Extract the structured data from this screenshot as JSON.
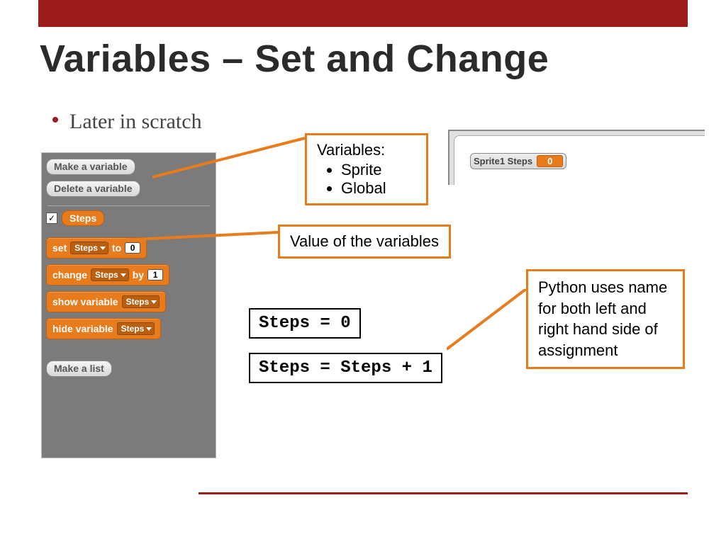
{
  "title": "Variables – Set and Change",
  "bullet": "Later in scratch",
  "scratch_panel": {
    "make_variable": "Make a variable",
    "delete_variable": "Delete a variable",
    "variable_checked": "✓",
    "variable_name": "Steps",
    "block_set_1": "set",
    "block_set_var": "Steps",
    "block_set_2": "to",
    "block_set_val": "0",
    "block_change_1": "change",
    "block_change_var": "Steps",
    "block_change_2": "by",
    "block_change_val": "1",
    "block_show_1": "show variable",
    "block_show_var": "Steps",
    "block_hide_1": "hide variable",
    "block_hide_var": "Steps",
    "make_list": "Make a list"
  },
  "stage_monitor": {
    "label": "Sprite1 Steps",
    "value": "0"
  },
  "callouts": {
    "variables_title": "Variables:",
    "variables_items": [
      "Sprite",
      "Global"
    ],
    "value_label": "Value of the variables",
    "python_note": "Python uses name for both left and right hand side of assignment"
  },
  "code": {
    "line1": "Steps = 0",
    "line2": "Steps = Steps + 1"
  }
}
